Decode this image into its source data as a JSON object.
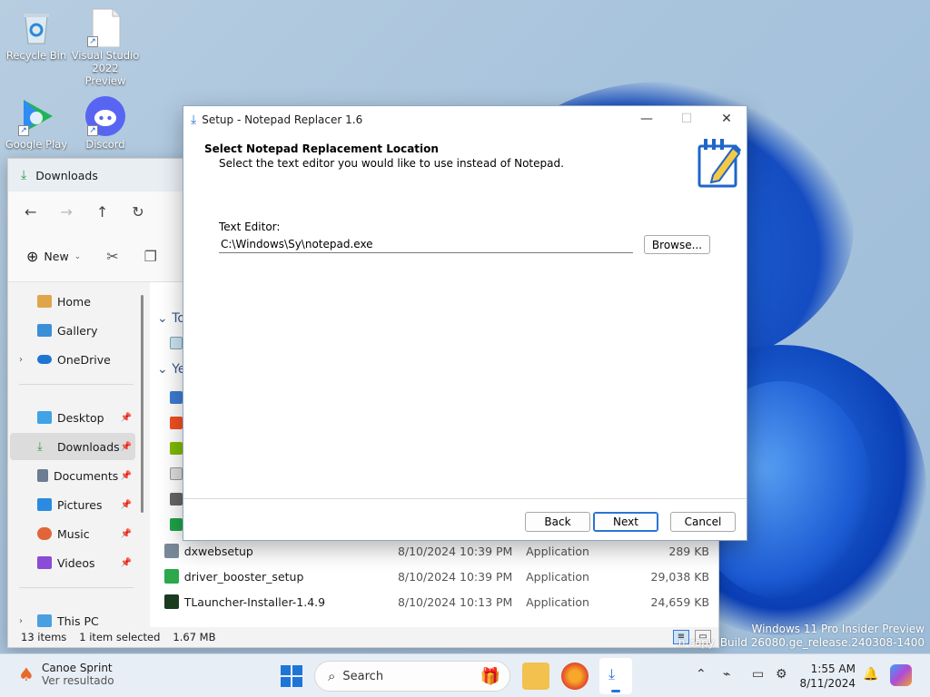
{
  "desktop": {
    "icons": [
      {
        "label": "Recycle Bin"
      },
      {
        "label": "Visual Studio 2022 Preview"
      },
      {
        "label": "Google Play"
      },
      {
        "label": "Discord"
      }
    ]
  },
  "explorer": {
    "tab_title": "Downloads",
    "new_label": "New",
    "sidebar": {
      "items": [
        {
          "label": "Home"
        },
        {
          "label": "Gallery"
        },
        {
          "label": "OneDrive"
        },
        {
          "label": "Desktop"
        },
        {
          "label": "Downloads"
        },
        {
          "label": "Documents"
        },
        {
          "label": "Pictures"
        },
        {
          "label": "Music"
        },
        {
          "label": "Videos"
        },
        {
          "label": "This PC"
        }
      ]
    },
    "group_today_partial": "To",
    "group_yesterday_partial": "Ye",
    "files": [
      {
        "name": "dxwebsetup",
        "date": "8/10/2024 10:39 PM",
        "type": "Application",
        "size": "289 KB"
      },
      {
        "name": "driver_booster_setup",
        "date": "8/10/2024 10:39 PM",
        "type": "Application",
        "size": "29,038 KB"
      },
      {
        "name": "TLauncher-Installer-1.4.9",
        "date": "8/10/2024 10:13 PM",
        "type": "Application",
        "size": "24,659 KB"
      }
    ],
    "status": {
      "items": "13 items",
      "selected": "1 item selected",
      "size": "1.67 MB"
    }
  },
  "dialog": {
    "title": "Setup - Notepad Replacer 1.6",
    "heading": "Select Notepad Replacement Location",
    "subheading": "Select the text editor you would like to use instead of Notepad.",
    "field_label": "Text Editor:",
    "field_value": "C:\\Windows\\Sy\\notepad.exe",
    "browse_label": "Browse...",
    "back_label": "Back",
    "next_label": "Next",
    "cancel_label": "Cancel"
  },
  "taskbar": {
    "weather_title": "Canoe Sprint",
    "weather_sub": "Ver resultado",
    "search_label": "Search",
    "time": "1:55 AM",
    "date": "8/11/2024"
  },
  "watermark": {
    "line1": "Windows 11 Pro Insider Preview",
    "line2": "n copy. Build 26080.ge_release.240308-1400"
  },
  "colors": {
    "accent": "#2a74d4",
    "wallpaper": "#a9c4dd"
  }
}
